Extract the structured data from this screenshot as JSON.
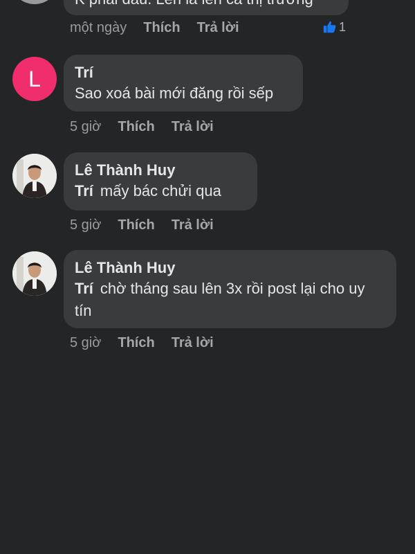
{
  "comments": [
    {
      "text": "K phải đâu. Lên là lên cả thị trường",
      "time": "một ngày",
      "like_label": "Thích",
      "reply_label": "Trả lời",
      "reaction_count": "1"
    },
    {
      "avatar_letter": "L",
      "author": "Trí",
      "text": "Sao xoá bài mới đăng rồi sếp",
      "time": "5 giờ",
      "like_label": "Thích",
      "reply_label": "Trả lời"
    },
    {
      "author": "Lê Thành Huy",
      "mention": "Trí",
      "text": "mấy bác chửi qua",
      "time": "5 giờ",
      "like_label": "Thích",
      "reply_label": "Trả lời"
    },
    {
      "author": "Lê Thành Huy",
      "mention": "Trí",
      "text": "chờ tháng sau lên 3x rồi post lại cho uy tín",
      "time": "5 giờ",
      "like_label": "Thích",
      "reply_label": "Trả lời"
    }
  ],
  "colors": {
    "background": "#242526",
    "bubble": "#3a3b3c",
    "avatar_letter_bg": "#f02d6d",
    "like_blue": "#1877f2"
  },
  "icons": {
    "reaction": "thumbs-up-icon"
  }
}
